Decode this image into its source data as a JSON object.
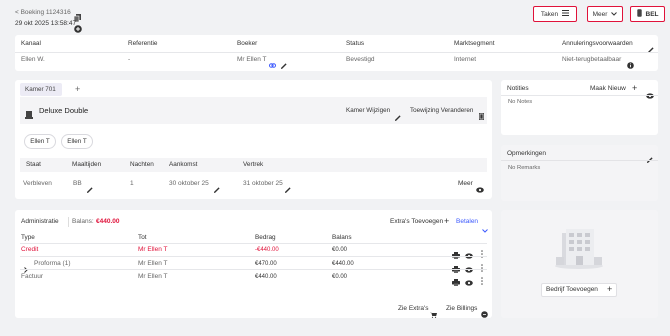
{
  "header": {
    "booking_label": "< Boeking 1124316",
    "datetime": "29 okt 2025 13:58:47",
    "taken_label": "Taken",
    "meer_label": "Meer",
    "bel_label": "BEL"
  },
  "summary": {
    "columns": [
      "Kanaal",
      "Referentie",
      "Boeker",
      "Status",
      "Marktsegment",
      "Annuleringsvoorwaarden"
    ],
    "values": [
      "Ellen W.",
      "-",
      "Mr Ellen T",
      "Bevestigd",
      "Internet",
      "Niet-terugbetaalbaar"
    ]
  },
  "room": {
    "tab_label": "Kamer 701",
    "add_tab": "+",
    "room_type": "Deluxe Double",
    "change_room_label": "Kamer Wijzigen",
    "change_assignment_label": "Toewijzing Veranderen",
    "guests": [
      "Ellen T",
      "Ellen T"
    ],
    "columns": [
      "Staat",
      "Maaltijden",
      "Nachten",
      "Aankomst",
      "Vertrek"
    ],
    "row": [
      "Verbleven",
      "BB",
      "1",
      "30 oktober 25",
      "31 oktober 25"
    ],
    "more_label": "Meer"
  },
  "admin": {
    "title": "Administratie",
    "balance_label": "Balans:",
    "balance_value": "€440.00",
    "extras_add_label": "Extra's Toevoegen",
    "pay_label": "Betalen",
    "columns": [
      "Type",
      "Tot",
      "Bedrag",
      "Balans"
    ],
    "rows": [
      {
        "type": "Credit",
        "to": "Mr Ellen T",
        "amount": "-€440.00",
        "balance": "€0.00"
      },
      {
        "type": "Proforma (1)",
        "to": "Mr Ellen T",
        "amount": "€470.00",
        "balance": "€440.00"
      },
      {
        "type": "Factuur",
        "to": "Mr Ellen T",
        "amount": "€440.00",
        "balance": "€0.00"
      }
    ],
    "see_extras_label": "Zie Extra's",
    "see_billings_label": "Zie Billings"
  },
  "notes": {
    "title": "Notities",
    "new_label": "Maak Nieuw",
    "empty": "No Notes"
  },
  "remarks": {
    "title": "Opmerkingen",
    "empty": "No Remarks"
  },
  "company": {
    "add_label": "Bedrijf Toevoegen"
  },
  "colors": {
    "accent": "#e0123a",
    "link": "#3d5afe",
    "tab_bg": "#ecebf5"
  }
}
